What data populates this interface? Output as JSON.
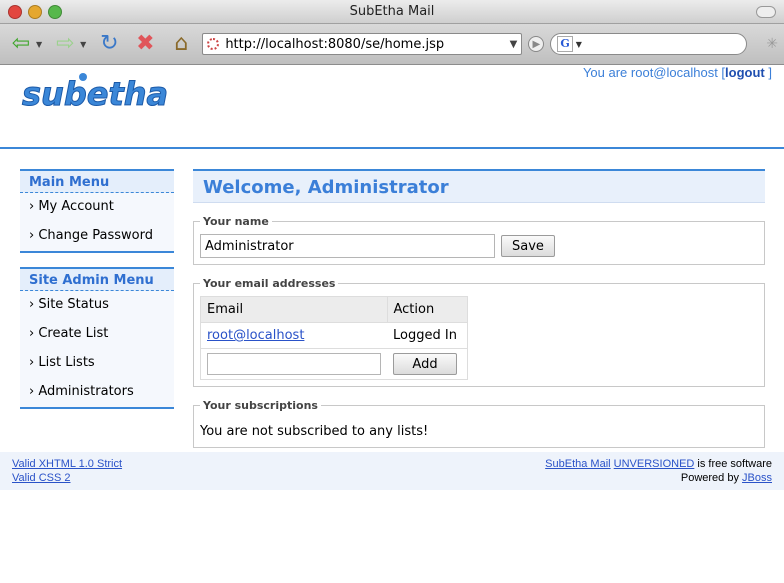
{
  "window": {
    "title": "SubEtha Mail"
  },
  "browser": {
    "url": "http://localhost:8080/se/home.jsp",
    "search_placeholder": ""
  },
  "header": {
    "logo_text": "subetha",
    "user_prefix": "You are root@localhost [",
    "logout_label": "logout",
    "user_suffix": " ]"
  },
  "sidebar": {
    "main_menu": {
      "title": "Main Menu",
      "items": [
        {
          "label": "My Account"
        },
        {
          "label": "Change Password"
        }
      ]
    },
    "site_admin_menu": {
      "title": "Site Admin Menu",
      "items": [
        {
          "label": "Site Status"
        },
        {
          "label": "Create List"
        },
        {
          "label": "List Lists"
        },
        {
          "label": "Administrators"
        }
      ]
    }
  },
  "main": {
    "welcome": "Welcome, Administrator",
    "name_section": {
      "legend": "Your name",
      "value": "Administrator",
      "save_label": "Save"
    },
    "email_section": {
      "legend": "Your email addresses",
      "columns": [
        "Email",
        "Action"
      ],
      "rows": [
        {
          "email": "root@localhost",
          "action": "Logged In"
        }
      ],
      "add_label": "Add"
    },
    "subscriptions": {
      "legend": "Your subscriptions",
      "text": "You are not subscribed to any lists!"
    }
  },
  "footer": {
    "xhtml": "Valid XHTML 1.0 Strict",
    "css": "Valid CSS 2",
    "product": "SubEtha Mail",
    "version": "UNVERSIONED",
    "free_text": " is free software",
    "powered_prefix": "Powered by ",
    "powered_by": "JBoss"
  },
  "colors": {
    "accent": "#3b87d8",
    "link": "#2a52c8"
  }
}
